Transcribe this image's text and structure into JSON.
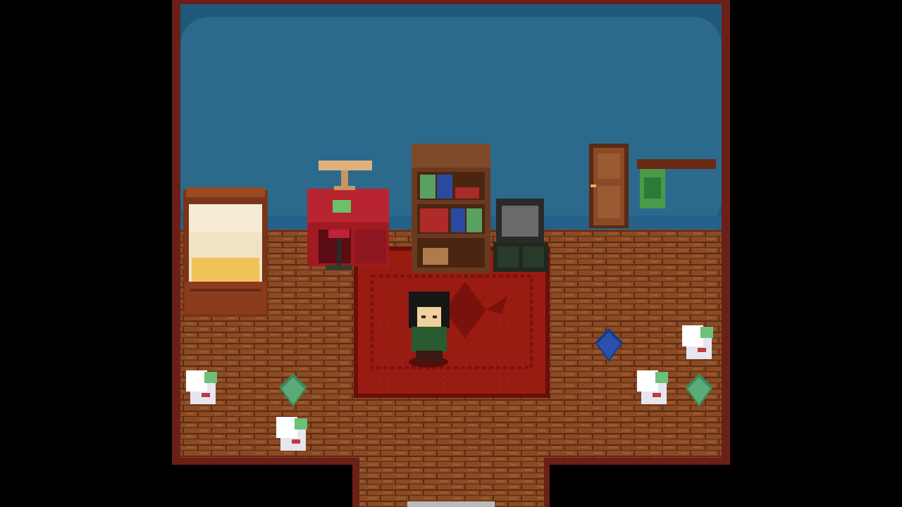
{
  "scene": {
    "name": "bedroom",
    "colors": {
      "background": "#000000",
      "wall": "#2b6a8c",
      "wall_trim": "#1f5878",
      "floor_brick": "#8a4a24",
      "floor_mortar": "#5c2c12",
      "border": "#6a1f17",
      "rug": "#9a1b12",
      "rug_pattern": "#7a120c"
    }
  },
  "objects": {
    "bed": {
      "icon": "bed"
    },
    "desk": {
      "icon": "red-desk"
    },
    "lamp": {
      "icon": "desk-lamp"
    },
    "stool": {
      "icon": "stool"
    },
    "bookshelf": {
      "icon": "bookshelf"
    },
    "tv": {
      "icon": "crt-television"
    },
    "door": {
      "icon": "wooden-door"
    },
    "coat_rack": {
      "icon": "coat-rack"
    },
    "rug": {
      "icon": "red-rug"
    },
    "player": {
      "icon": "hooded-character"
    },
    "pickups": [
      {
        "type": "letter-stack",
        "icon": "letters-icon"
      },
      {
        "type": "book-green",
        "icon": "green-book-icon"
      },
      {
        "type": "letter-stack",
        "icon": "letters-icon"
      },
      {
        "type": "book-blue",
        "icon": "blue-book-icon"
      },
      {
        "type": "letter-stack",
        "icon": "letters-icon"
      },
      {
        "type": "letter-stack",
        "icon": "letters-icon"
      },
      {
        "type": "book-green",
        "icon": "green-book-icon"
      }
    ]
  }
}
